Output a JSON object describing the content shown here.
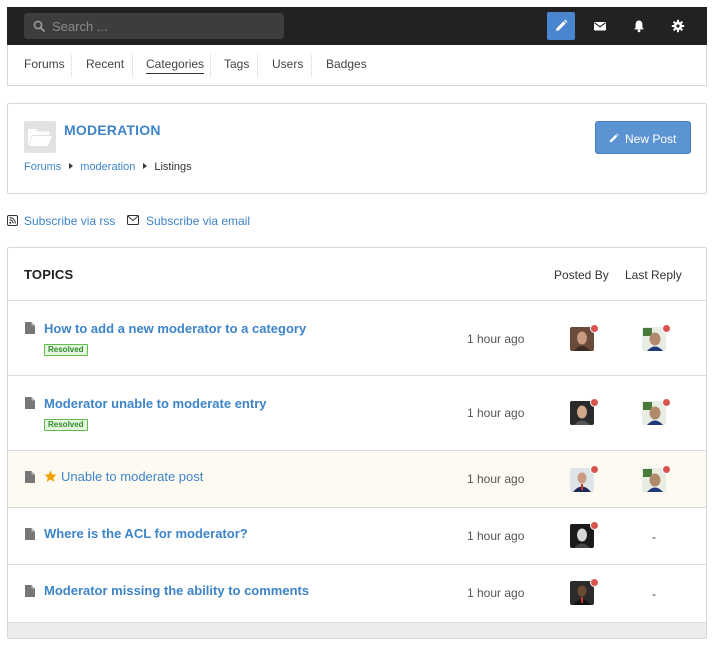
{
  "search": {
    "placeholder": "Search ..."
  },
  "toolbar": {
    "icons": [
      "pencil-icon",
      "envelope-icon",
      "bell-icon",
      "gear-icon"
    ]
  },
  "nav": {
    "items": [
      {
        "label": "Forums"
      },
      {
        "label": "Recent"
      },
      {
        "label": "Categories",
        "active": true
      },
      {
        "label": "Tags"
      },
      {
        "label": "Users"
      },
      {
        "label": "Badges"
      }
    ]
  },
  "category": {
    "title": "MODERATION",
    "new_post_label": "New Post",
    "breadcrumb": [
      "Forums",
      "moderation",
      "Listings"
    ]
  },
  "subscribe": {
    "rss": "Subscribe via rss",
    "email": "Subscribe via email"
  },
  "topics": {
    "heading": "TOPICS",
    "col_posted_by": "Posted By",
    "col_last_reply": "Last Reply",
    "rows": [
      {
        "title": "How to add a new moderator to a category",
        "badge": "Resolved",
        "time": "1 hour ago",
        "last_reply": "avatar"
      },
      {
        "title": "Moderator unable to moderate entry",
        "badge": "Resolved",
        "time": "1 hour ago",
        "last_reply": "avatar"
      },
      {
        "title": "Unable to moderate post",
        "starred": true,
        "time": "1 hour ago",
        "last_reply": "avatar"
      },
      {
        "title": "Where is the ACL for moderator?",
        "time": "1 hour ago",
        "last_reply": "-"
      },
      {
        "title": "Moderator missing the ability to comments",
        "time": "1 hour ago",
        "last_reply": "-"
      }
    ]
  },
  "colors": {
    "accent": "#3d84c8",
    "topbar": "#222222",
    "button": "#5b93d3",
    "resolved": "#5fbf4a",
    "online_dot": "#d9534f",
    "star": "#f0a30a"
  }
}
